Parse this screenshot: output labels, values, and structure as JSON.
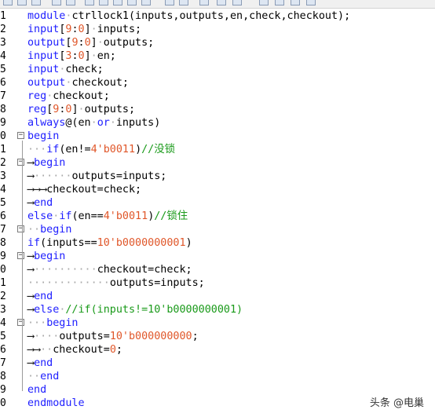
{
  "editor": {
    "lines": [
      {
        "n": "1",
        "fold": "",
        "tokens": [
          [
            "kw",
            "module"
          ],
          [
            "ws",
            "·"
          ],
          [
            "txt",
            "ctrllock1(inputs,outputs,en,check,checkout);"
          ]
        ]
      },
      {
        "n": "2",
        "fold": "",
        "tokens": [
          [
            "kw",
            "input"
          ],
          [
            "txt",
            "["
          ],
          [
            "num",
            "9"
          ],
          [
            "txt",
            ":"
          ],
          [
            "num",
            "0"
          ],
          [
            "txt",
            "]"
          ],
          [
            "ws",
            "·"
          ],
          [
            "txt",
            "inputs;"
          ]
        ]
      },
      {
        "n": "3",
        "fold": "",
        "tokens": [
          [
            "kw",
            "output"
          ],
          [
            "txt",
            "["
          ],
          [
            "num",
            "9"
          ],
          [
            "txt",
            ":"
          ],
          [
            "num",
            "0"
          ],
          [
            "txt",
            "]"
          ],
          [
            "ws",
            "·"
          ],
          [
            "txt",
            "outputs;"
          ]
        ]
      },
      {
        "n": "4",
        "fold": "",
        "tokens": [
          [
            "kw",
            "input"
          ],
          [
            "txt",
            "["
          ],
          [
            "num",
            "3"
          ],
          [
            "txt",
            ":"
          ],
          [
            "num",
            "0"
          ],
          [
            "txt",
            "]"
          ],
          [
            "ws",
            "·"
          ],
          [
            "txt",
            "en;"
          ]
        ]
      },
      {
        "n": "5",
        "fold": "",
        "tokens": [
          [
            "kw",
            "input"
          ],
          [
            "ws",
            "·"
          ],
          [
            "txt",
            "check;"
          ]
        ]
      },
      {
        "n": "6",
        "fold": "",
        "tokens": [
          [
            "kw",
            "output"
          ],
          [
            "ws",
            "·"
          ],
          [
            "txt",
            "checkout;"
          ]
        ]
      },
      {
        "n": "7",
        "fold": "",
        "tokens": [
          [
            "kw",
            "reg"
          ],
          [
            "ws",
            "·"
          ],
          [
            "txt",
            "checkout;"
          ]
        ]
      },
      {
        "n": "8",
        "fold": "",
        "tokens": [
          [
            "kw",
            "reg"
          ],
          [
            "txt",
            "["
          ],
          [
            "num",
            "9"
          ],
          [
            "txt",
            ":"
          ],
          [
            "num",
            "0"
          ],
          [
            "txt",
            "]"
          ],
          [
            "ws",
            "·"
          ],
          [
            "txt",
            "outputs;"
          ]
        ]
      },
      {
        "n": "9",
        "fold": "",
        "tokens": [
          [
            "kw",
            "always"
          ],
          [
            "txt",
            "@(en"
          ],
          [
            "ws",
            "·"
          ],
          [
            "kw",
            "or"
          ],
          [
            "ws",
            "·"
          ],
          [
            "txt",
            "inputs)"
          ]
        ]
      },
      {
        "n": "0",
        "fold": "⊟",
        "tokens": [
          [
            "kw",
            "begin"
          ]
        ]
      },
      {
        "n": "1",
        "fold": "",
        "tokens": [
          [
            "ws",
            "···"
          ],
          [
            "kw",
            "if"
          ],
          [
            "txt",
            "(en!="
          ],
          [
            "num",
            "4'b0011"
          ],
          [
            "txt",
            ")"
          ],
          [
            "cmt",
            "//没锁"
          ]
        ]
      },
      {
        "n": "2",
        "fold": "⊟",
        "tokens": [
          [
            "arrow",
            "⟶"
          ],
          [
            "kw",
            "begin"
          ]
        ]
      },
      {
        "n": "3",
        "fold": "",
        "tokens": [
          [
            "arrow",
            "⟶"
          ],
          [
            "ws",
            "······"
          ],
          [
            "txt",
            "outputs=inputs;"
          ]
        ]
      },
      {
        "n": "4",
        "fold": "",
        "tokens": [
          [
            "arrow",
            "⟶⟶⟶"
          ],
          [
            "txt",
            "checkout=check;"
          ]
        ]
      },
      {
        "n": "5",
        "fold": "",
        "tokens": [
          [
            "arrow",
            "⟶"
          ],
          [
            "kw",
            "end"
          ]
        ]
      },
      {
        "n": "6",
        "fold": "",
        "tokens": [
          [
            "kw",
            "else"
          ],
          [
            "ws",
            "·"
          ],
          [
            "kw",
            "if"
          ],
          [
            "txt",
            "(en=="
          ],
          [
            "num",
            "4'b0011"
          ],
          [
            "txt",
            ")"
          ],
          [
            "cmt",
            "//锁住"
          ]
        ]
      },
      {
        "n": "7",
        "fold": "⊟",
        "tokens": [
          [
            "ws",
            "··"
          ],
          [
            "kw",
            "begin"
          ]
        ]
      },
      {
        "n": "8",
        "fold": "",
        "tokens": [
          [
            "kw",
            "if"
          ],
          [
            "txt",
            "(inputs=="
          ],
          [
            "num",
            "10'b0000000001"
          ],
          [
            "txt",
            ")"
          ]
        ]
      },
      {
        "n": "9",
        "fold": "⊟",
        "tokens": [
          [
            "arrow",
            "⟶"
          ],
          [
            "kw",
            "begin"
          ]
        ]
      },
      {
        "n": "0",
        "fold": "",
        "tokens": [
          [
            "arrow",
            "⟶"
          ],
          [
            "ws",
            "··········"
          ],
          [
            "txt",
            "checkout=check;"
          ]
        ]
      },
      {
        "n": "1",
        "fold": "",
        "tokens": [
          [
            "ws",
            "·············"
          ],
          [
            "txt",
            "outputs=inputs;"
          ]
        ]
      },
      {
        "n": "2",
        "fold": "",
        "tokens": [
          [
            "arrow",
            "⟶"
          ],
          [
            "kw",
            "end"
          ]
        ]
      },
      {
        "n": "3",
        "fold": "",
        "tokens": [
          [
            "arrow",
            "⟶"
          ],
          [
            "kw",
            "else"
          ],
          [
            "ws",
            "·"
          ],
          [
            "cmt",
            "//if(inputs!=10'b0000000001)"
          ]
        ]
      },
      {
        "n": "4",
        "fold": "⊟",
        "tokens": [
          [
            "ws",
            "···"
          ],
          [
            "kw",
            "begin"
          ]
        ]
      },
      {
        "n": "5",
        "fold": "",
        "tokens": [
          [
            "arrow",
            "⟶"
          ],
          [
            "ws",
            "····"
          ],
          [
            "txt",
            "outputs="
          ],
          [
            "num",
            "10'b000000000"
          ],
          [
            "txt",
            ";"
          ]
        ]
      },
      {
        "n": "6",
        "fold": "",
        "tokens": [
          [
            "arrow",
            "⟶⟶"
          ],
          [
            "ws",
            "··"
          ],
          [
            "txt",
            "checkout="
          ],
          [
            "num",
            "0"
          ],
          [
            "txt",
            ";"
          ]
        ]
      },
      {
        "n": "7",
        "fold": "",
        "tokens": [
          [
            "arrow",
            "⟶"
          ],
          [
            "kw",
            "end"
          ]
        ]
      },
      {
        "n": "8",
        "fold": "",
        "tokens": [
          [
            "ws",
            "··"
          ],
          [
            "kw",
            "end"
          ]
        ]
      },
      {
        "n": "9",
        "fold": "",
        "tokens": [
          [
            "kw",
            "end"
          ]
        ]
      },
      {
        "n": "0",
        "fold": "",
        "tokens": [
          [
            "kw",
            "endmodule"
          ]
        ]
      }
    ]
  },
  "watermark": "头条 @电巢"
}
